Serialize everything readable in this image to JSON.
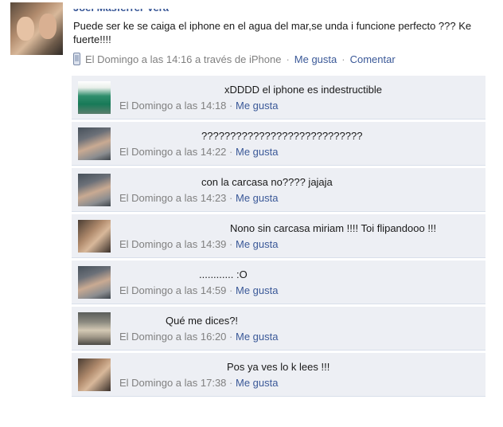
{
  "post": {
    "author": "Joel Masferrer Vera",
    "text": "Puede ser ke se caiga el iphone en el agua del mar,se unda i funcione perfecto ??? Ke fuerte!!!!",
    "time": "El Domingo a las 14:16 a través de iPhone",
    "like_label": "Me gusta",
    "comment_label": "Comentar"
  },
  "comments": [
    {
      "avatar": "green",
      "text": "xDDDD el iphone es indestructible",
      "time": "El Domingo a las 14:18",
      "like": "Me gusta"
    },
    {
      "avatar": "miriam",
      "text": "????????????????????????????",
      "time": "El Domingo a las 14:22",
      "like": "Me gusta"
    },
    {
      "avatar": "miriam",
      "text": "con la carcasa no???? jajaja",
      "time": "El Domingo a las 14:23",
      "like": "Me gusta"
    },
    {
      "avatar": "joel",
      "text": "Nono sin carcasa miriam !!!! Toi flipandooo !!!",
      "time": "El Domingo a las 14:39",
      "like": "Me gusta"
    },
    {
      "avatar": "miriam",
      "text": "............ :O",
      "time": "El Domingo a las 14:59",
      "like": "Me gusta"
    },
    {
      "avatar": "group",
      "text": "Qué me dices?!",
      "time": "El Domingo a las 16:20",
      "like": "Me gusta"
    },
    {
      "avatar": "joel",
      "text": "Pos ya ves lo k lees !!!",
      "time": "El Domingo a las 17:38",
      "like": "Me gusta"
    }
  ]
}
